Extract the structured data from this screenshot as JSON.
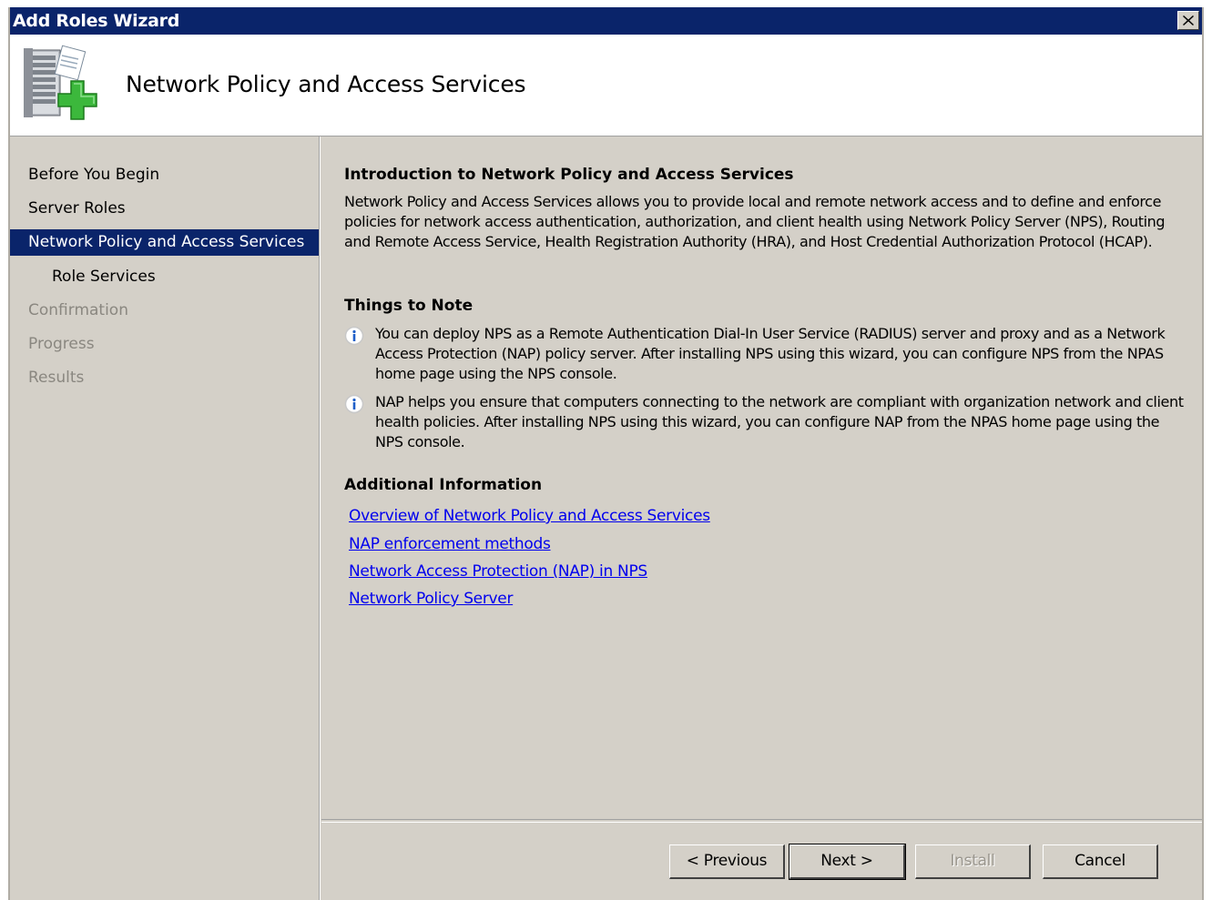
{
  "window": {
    "title": "Add Roles Wizard",
    "close_glyph": "✕"
  },
  "header": {
    "heading": "Network Policy and Access Services",
    "icon": "server-add-role-icon"
  },
  "sidebar": {
    "items": [
      {
        "label": "Before You Begin",
        "state": "normal"
      },
      {
        "label": "Server Roles",
        "state": "normal"
      },
      {
        "label": "Network Policy and Access Services",
        "state": "active"
      },
      {
        "label": "Role Services",
        "state": "normal"
      },
      {
        "label": "Confirmation",
        "state": "disabled"
      },
      {
        "label": "Progress",
        "state": "disabled"
      },
      {
        "label": "Results",
        "state": "disabled"
      }
    ]
  },
  "content": {
    "intro_title": "Introduction to Network Policy and Access Services",
    "intro_text": "Network Policy and Access Services allows you to provide local and remote network access and to define and enforce policies for network access authentication, authorization, and client health using Network Policy Server (NPS), Routing and Remote Access Service, Health Registration Authority (HRA), and Host Credential Authorization Protocol (HCAP).",
    "notes_title": "Things to Note",
    "notes": [
      "You can deploy NPS as a Remote Authentication Dial-In User Service (RADIUS) server and proxy and as a Network Access Protection (NAP) policy server. After installing NPS using this wizard, you can configure NPS from the NPAS home page using the NPS console.",
      "NAP helps you ensure that computers connecting to the network are compliant with organization network and client health policies. After installing NPS using this wizard, you can configure NAP from the NPAS home page using the NPS console."
    ],
    "additional_title": "Additional Information",
    "links": [
      "Overview of Network Policy and Access Services",
      "NAP enforcement methods",
      "Network Access Protection (NAP) in NPS",
      "Network Policy Server"
    ]
  },
  "buttons": {
    "previous": "< Previous",
    "next": "Next >",
    "install": "Install",
    "cancel": "Cancel"
  },
  "colors": {
    "titlebar": "#0a246a",
    "face": "#d4d0c8",
    "link": "#0000ee",
    "selection": "#0a246a"
  }
}
